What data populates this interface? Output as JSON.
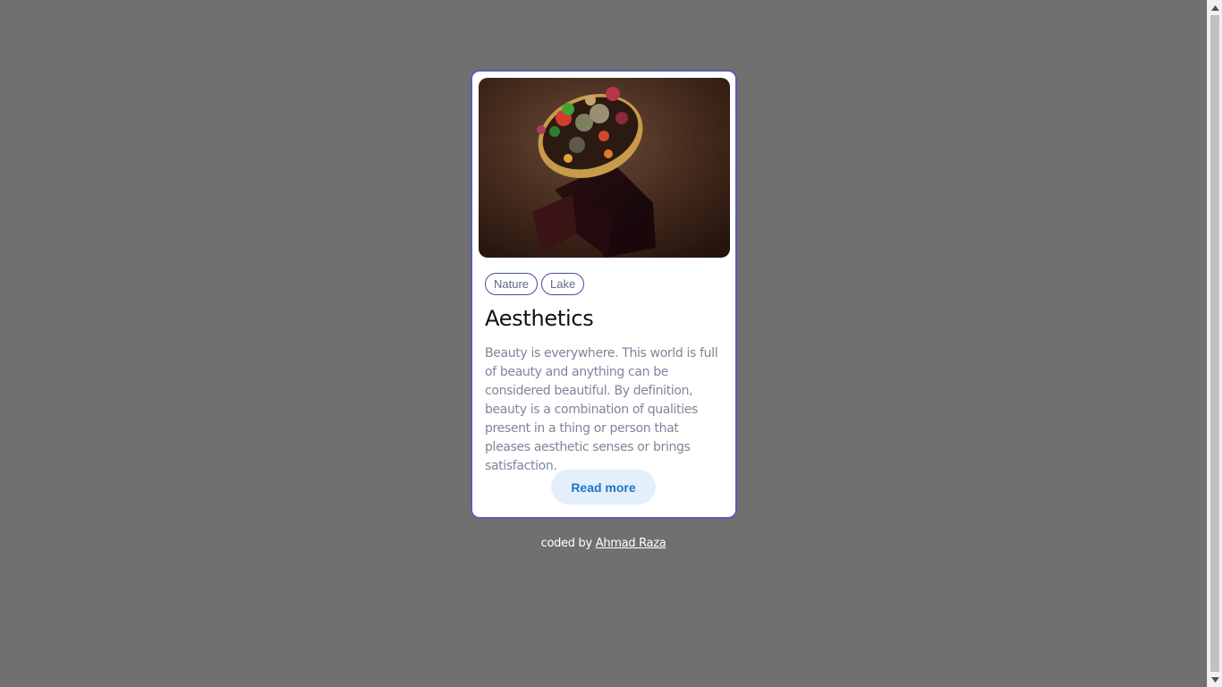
{
  "card": {
    "image_alt": "Taco topped with colorful flowers and greens on a dark wooden block",
    "tags": [
      "Nature",
      "Lake"
    ],
    "title": "Aesthetics",
    "description": "Beauty is everywhere. This world is full of beauty and anything can be considered beautiful. By definition, beauty is a combination of qualities present in a thing or person that pleases aesthetic senses or brings satisfaction.",
    "button_label": "Read more"
  },
  "footer": {
    "prefix": "coded by ",
    "author": "Ahmad Raza"
  },
  "colors": {
    "background": "#707070",
    "card_border": "#5d5bb8",
    "button_bg": "#e3f0fc",
    "button_text": "#1e74c9",
    "body_text": "#7d8699"
  },
  "icons": {
    "scroll_up": "chevron-up-icon",
    "scroll_down": "chevron-down-icon"
  }
}
